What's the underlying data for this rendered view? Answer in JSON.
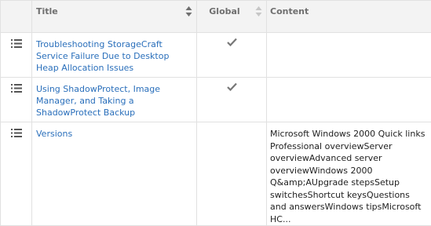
{
  "columns": {
    "title": "Title",
    "global": "Global",
    "content": "Content"
  },
  "rows": [
    {
      "title": "Troubleshooting StorageCraft Service Failure Due to Desktop Heap Allocation Issues",
      "global": true,
      "content": ""
    },
    {
      "title": "Using ShadowProtect, Image Manager, and Taking a ShadowProtect Backup",
      "global": true,
      "content": ""
    },
    {
      "title": "Versions",
      "global": false,
      "content": "Microsoft Windows 2000 Quick links Professional overviewServer overviewAdvanced server overviewWindows 2000 Q&amp;AUpgrade stepsSetup switchesShortcut keysQuestions and answersWindows tipsMicrosoft HC..."
    }
  ],
  "icons": {
    "row_handle": "list-icon",
    "global_check": "checkmark-icon",
    "sort": "sort-icon"
  },
  "colors": {
    "link": "#2a6fbb",
    "header_bg": "#f3f3f3",
    "border": "#e1e1e1",
    "check": "#777777"
  }
}
